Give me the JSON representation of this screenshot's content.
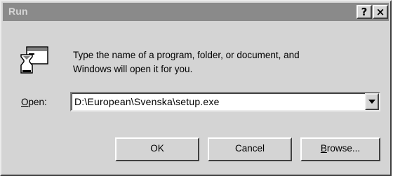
{
  "window": {
    "title": "Run"
  },
  "caption_buttons": {
    "help": "?",
    "close": "×"
  },
  "dialog": {
    "description_line1": "Type the name of a program, folder, or document, and",
    "description_line2": "Windows will open it for you.",
    "open_label_prefix": "O",
    "open_label_rest": "pen:",
    "open_value": "D:\\European\\Svenska\\setup.exe"
  },
  "buttons": {
    "ok": "OK",
    "cancel": "Cancel",
    "browse_prefix": "B",
    "browse_rest": "rowse..."
  }
}
